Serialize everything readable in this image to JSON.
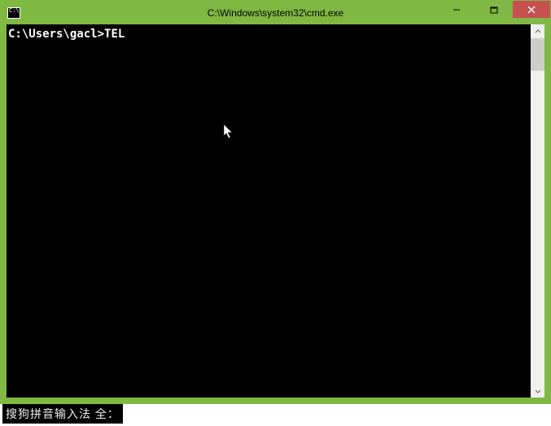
{
  "window": {
    "title": "C:\\Windows\\system32\\cmd.exe",
    "controls": {
      "min_icon": "minimize-icon",
      "max_icon": "maximize-icon",
      "close_icon": "close-icon"
    }
  },
  "console": {
    "prompt": "C:\\Users\\gacl>",
    "input": "TEL"
  },
  "ime": {
    "status": "搜狗拼音输入法 全："
  }
}
